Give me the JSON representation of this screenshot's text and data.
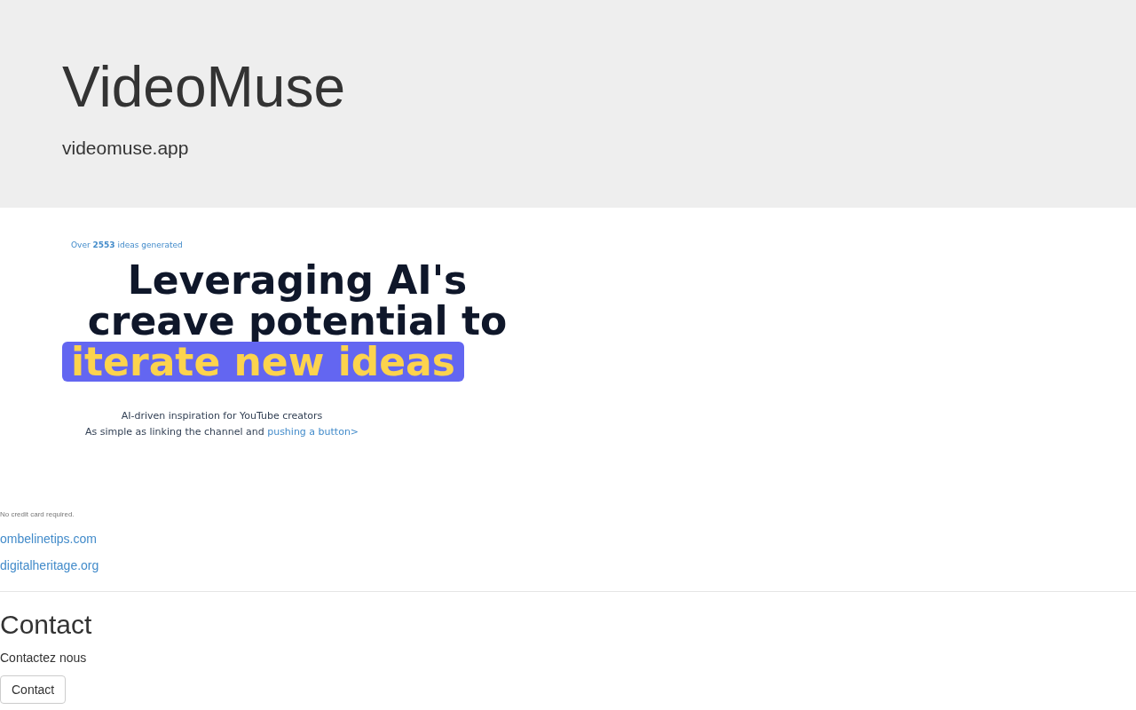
{
  "header": {
    "title": "VideoMuse",
    "domain": "videomuse.app"
  },
  "hero": {
    "counter": "Over **2553** ideas generated",
    "headline_lines": [
      "Leveraging AI's",
      "creave potential to"
    ],
    "highlight": "iterate new ideas",
    "tagline": "AI-driven inspiration for YouTube creators",
    "subtext": "As simple as linking the channel and",
    "subtext_link": "pushing a button>"
  },
  "note": "No credit card required.",
  "links": [
    "ombelinetips.com",
    "digitalheritage.org"
  ],
  "contact": {
    "heading": "Contact",
    "text": "Contactez nous",
    "button": "Contact"
  }
}
